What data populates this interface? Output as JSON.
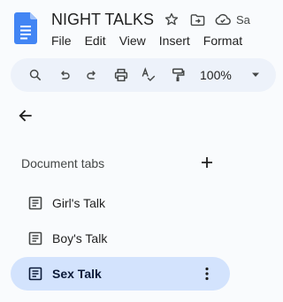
{
  "app": {
    "icon": "google-docs-icon",
    "accent": "#1a73e8"
  },
  "document": {
    "title": "NIGHT TALKS",
    "save_status_partial": "Sa"
  },
  "title_icons": [
    "star-icon",
    "move-to-folder-icon",
    "cloud-saved-icon"
  ],
  "menu": [
    "File",
    "Edit",
    "View",
    "Insert",
    "Format"
  ],
  "toolbar": {
    "tools": [
      "search-icon",
      "undo-icon",
      "redo-icon",
      "print-icon",
      "spelling-check-icon",
      "paint-format-icon"
    ],
    "zoom": "100%"
  },
  "sidebar": {
    "back": "arrow-back-icon",
    "header": "Document tabs",
    "add": "plus-icon",
    "tabs": [
      {
        "label": "Girl's Talk",
        "active": false
      },
      {
        "label": "Boy's Talk",
        "active": false
      },
      {
        "label": "Sex Talk",
        "active": true
      }
    ],
    "active_tab_color": "#d3e3fd"
  }
}
